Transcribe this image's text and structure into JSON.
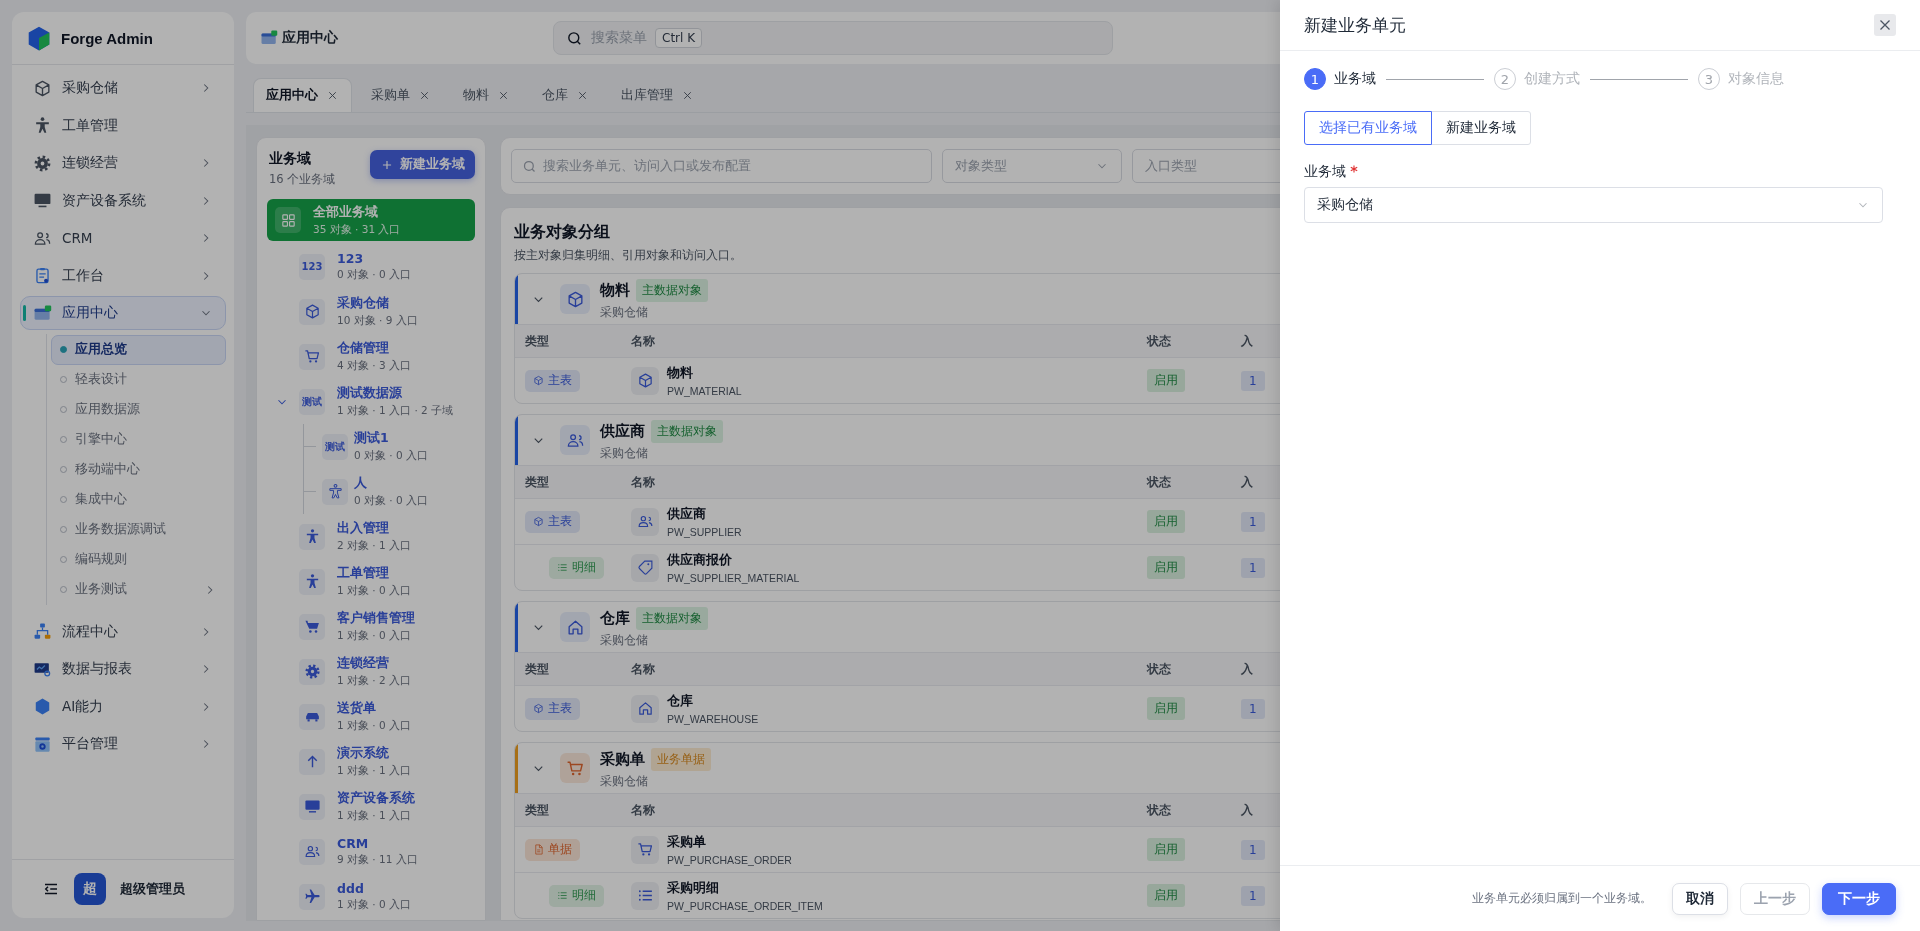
{
  "brand": {
    "name": "Forge Admin"
  },
  "menu": [
    {
      "label": "采购仓储",
      "kind": "group",
      "expanded": false,
      "selected": false
    },
    {
      "label": "工单管理",
      "kind": "link",
      "selected": false
    },
    {
      "label": "连锁经营",
      "kind": "group",
      "expanded": false,
      "selected": false
    },
    {
      "label": "资产设备系统",
      "kind": "group",
      "expanded": false,
      "selected": false
    },
    {
      "label": "CRM",
      "kind": "group",
      "expanded": false,
      "selected": false
    },
    {
      "label": "工作台",
      "kind": "group",
      "expanded": false,
      "selected": false
    },
    {
      "label": "应用中心",
      "kind": "group",
      "expanded": true,
      "selected": true,
      "children": [
        {
          "label": "应用总览",
          "kind": "link",
          "selected": true
        },
        {
          "label": "轻表设计",
          "kind": "link",
          "selected": false
        },
        {
          "label": "应用数据源",
          "kind": "link",
          "selected": false
        },
        {
          "label": "引擎中心",
          "kind": "link",
          "selected": false
        },
        {
          "label": "移动端中心",
          "kind": "link",
          "selected": false
        },
        {
          "label": "集成中心",
          "kind": "link",
          "selected": false
        },
        {
          "label": "业务数据源调试",
          "kind": "link",
          "selected": false
        },
        {
          "label": "编码规则",
          "kind": "link",
          "selected": false
        },
        {
          "label": "业务测试",
          "kind": "group",
          "expanded": false,
          "selected": false
        }
      ]
    },
    {
      "label": "流程中心",
      "kind": "group",
      "expanded": false,
      "selected": false
    },
    {
      "label": "数据与报表",
      "kind": "group",
      "expanded": false,
      "selected": false
    },
    {
      "label": "AI能力",
      "kind": "group",
      "expanded": false,
      "selected": false
    },
    {
      "label": "平台管理",
      "kind": "group",
      "expanded": false,
      "selected": false
    }
  ],
  "user": {
    "avatar": "超",
    "name": "超级管理员"
  },
  "topbar": {
    "title": "应用中心",
    "search": {
      "placeholder": "搜索菜单",
      "shortcut": "Ctrl K"
    }
  },
  "tabs": [
    {
      "label": "应用中心",
      "selected": true
    },
    {
      "label": "采购单",
      "selected": false
    },
    {
      "label": "物料",
      "selected": false
    },
    {
      "label": "仓库",
      "selected": false
    },
    {
      "label": "出库管理",
      "selected": false
    }
  ],
  "domain_panel": {
    "title": "业务域",
    "count": "16 个业务域",
    "add_button": "新建业务域"
  },
  "domains": [
    {
      "kind": "all",
      "name": "全部业务域",
      "meta": "35 对象 · 31 入口",
      "selected": true
    },
    {
      "kind": "domain",
      "badge": "123",
      "name": "123",
      "meta": "0 对象 · 0 入口",
      "selected": false
    },
    {
      "kind": "domain",
      "name": "采购仓储",
      "meta": "10 对象 · 9 入口",
      "selected": false
    },
    {
      "kind": "domain",
      "name": "仓储管理",
      "meta": "4 对象 · 3 入口",
      "selected": false
    },
    {
      "kind": "domain",
      "badge": "测试",
      "name": "测试数据源",
      "meta": "1 对象 · 1 入口 · 2 子域",
      "selected": false,
      "expanded": true,
      "children": [
        {
          "badge": "测试",
          "name": "测试1",
          "meta": "0 对象 · 0 入口",
          "selected": false
        },
        {
          "name": "人",
          "meta": "0 对象 · 0 入口",
          "selected": false
        }
      ]
    },
    {
      "kind": "domain",
      "name": "出入管理",
      "meta": "2 对象 · 1 入口",
      "selected": false
    },
    {
      "kind": "domain",
      "name": "工单管理",
      "meta": "1 对象 · 0 入口",
      "selected": false
    },
    {
      "kind": "domain",
      "name": "客户销售管理",
      "meta": "1 对象 · 0 入口",
      "selected": false
    },
    {
      "kind": "domain",
      "name": "连锁经营",
      "meta": "1 对象 · 2 入口",
      "selected": false
    },
    {
      "kind": "domain",
      "name": "送货单",
      "meta": "1 对象 · 0 入口",
      "selected": false
    },
    {
      "kind": "domain",
      "name": "演示系统",
      "meta": "1 对象 · 1 入口",
      "selected": false
    },
    {
      "kind": "domain",
      "name": "资产设备系统",
      "meta": "1 对象 · 1 入口",
      "selected": false
    },
    {
      "kind": "domain",
      "name": "CRM",
      "meta": "9 对象 · 11 入口",
      "selected": false
    },
    {
      "kind": "domain",
      "name": "ddd",
      "meta": "1 对象 · 0 入口",
      "selected": false
    }
  ],
  "filters": {
    "search": {
      "placeholder": "搜索业务单元、访问入口或发布配置"
    },
    "object_type": {
      "placeholder": "对象类型"
    },
    "entry_type": {
      "placeholder": "入口类型"
    }
  },
  "objects": {
    "title": "业务对象分组",
    "subtitle": "按主对象归集明细、引用对象和访问入口。"
  },
  "groups": [
    {
      "name": "物料",
      "tag": {
        "label": "主数据对象",
        "kind": "master"
      },
      "domain": "采购仓储",
      "expanded": true,
      "columns": [
        "类型",
        "名称",
        "状态",
        "入"
      ],
      "rows": [
        {
          "type": {
            "label": "主表",
            "kind": "main"
          },
          "name": "物料",
          "code": "PW_MATERIAL",
          "status": "启用",
          "entry": "1"
        }
      ]
    },
    {
      "name": "供应商",
      "tag": {
        "label": "主数据对象",
        "kind": "master"
      },
      "domain": "采购仓储",
      "expanded": true,
      "columns": [
        "类型",
        "名称",
        "状态",
        "入"
      ],
      "rows": [
        {
          "type": {
            "label": "主表",
            "kind": "main"
          },
          "name": "供应商",
          "code": "PW_SUPPLIER",
          "status": "启用",
          "entry": "1"
        },
        {
          "type": {
            "label": "明细",
            "kind": "detail"
          },
          "name": "供应商报价",
          "code": "PW_SUPPLIER_MATERIAL",
          "status": "启用",
          "entry": "1"
        }
      ]
    },
    {
      "name": "仓库",
      "tag": {
        "label": "主数据对象",
        "kind": "master"
      },
      "domain": "采购仓储",
      "expanded": true,
      "columns": [
        "类型",
        "名称",
        "状态",
        "入"
      ],
      "rows": [
        {
          "type": {
            "label": "主表",
            "kind": "main"
          },
          "name": "仓库",
          "code": "PW_WAREHOUSE",
          "status": "启用",
          "entry": "1"
        }
      ]
    },
    {
      "name": "采购单",
      "tag": {
        "label": "业务单据",
        "kind": "document"
      },
      "domain": "采购仓储",
      "expanded": true,
      "columns": [
        "类型",
        "名称",
        "状态",
        "入"
      ],
      "rows": [
        {
          "type": {
            "label": "单据",
            "kind": "doc"
          },
          "name": "采购单",
          "code": "PW_PURCHASE_ORDER",
          "status": "启用",
          "entry": "1"
        },
        {
          "type": {
            "label": "明细",
            "kind": "detail"
          },
          "name": "采购明细",
          "code": "PW_PURCHASE_ORDER_ITEM",
          "status": "启用",
          "entry": "1"
        }
      ]
    }
  ],
  "drawer": {
    "title": "新建业务单元",
    "steps": [
      {
        "number": "1",
        "label": "业务域",
        "selected": true
      },
      {
        "number": "2",
        "label": "创建方式",
        "selected": false
      },
      {
        "number": "3",
        "label": "对象信息",
        "selected": false
      }
    ],
    "modes": [
      {
        "label": "选择已有业务域",
        "selected": true
      },
      {
        "label": "新建业务域",
        "selected": false
      }
    ],
    "field": {
      "label": "业务域",
      "required": true,
      "value": "采购仓储"
    },
    "hint": "业务单元必须归属到一个业务域。",
    "buttons": [
      {
        "label": "取消",
        "kind": "default",
        "disabled": false
      },
      {
        "label": "上一步",
        "kind": "default",
        "disabled": true
      },
      {
        "label": "下一步",
        "kind": "primary",
        "disabled": false
      }
    ]
  }
}
